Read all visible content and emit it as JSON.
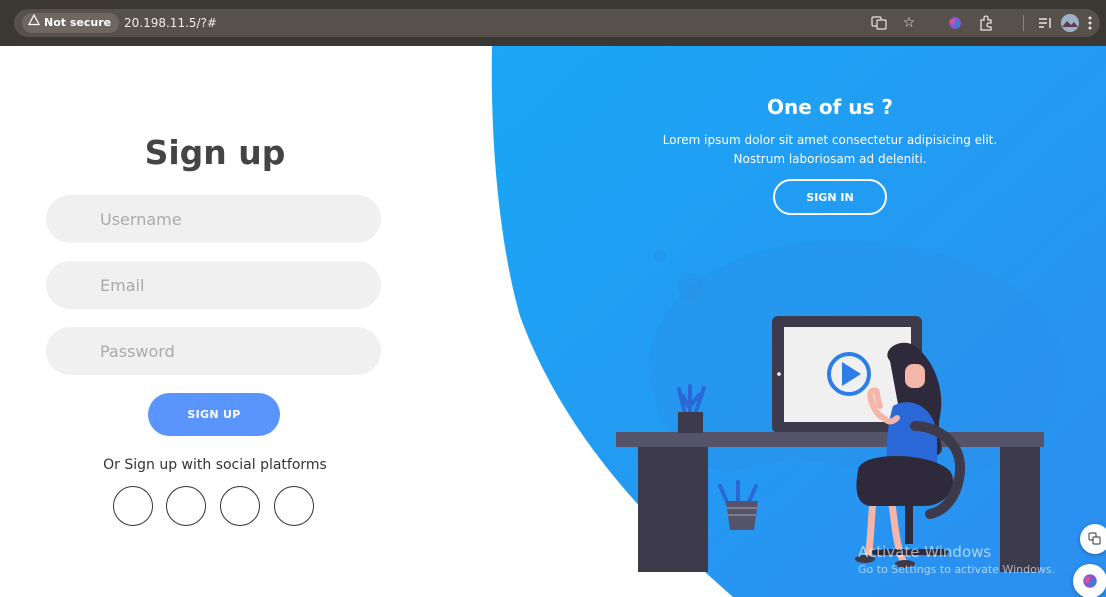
{
  "browser": {
    "security_label": "Not secure",
    "url": "20.198.11.5/?#"
  },
  "signup": {
    "title": "Sign up",
    "username_placeholder": "Username",
    "email_placeholder": "Email",
    "password_placeholder": "Password",
    "button_label": "SIGN UP",
    "social_text": "Or Sign up with social platforms"
  },
  "panel": {
    "title": "One of us ?",
    "text_line1": "Lorem ipsum dolor sit amet consectetur adipisicing elit.",
    "text_line2": "Nostrum laboriosam ad deleniti.",
    "button_label": "SIGN IN"
  },
  "watermark": {
    "line1": "Activate Windows",
    "line2": "Go to Settings to activate Windows."
  },
  "colors": {
    "primary": "#5995fd",
    "panel_gradient_start": "#1aa7f5",
    "panel_gradient_end": "#2c8ef0",
    "chrome": "#3b3833"
  },
  "icons": [
    "warning-icon",
    "translate-icon",
    "star-icon",
    "extension-icon",
    "puzzle-icon",
    "reading-list-icon",
    "profile-avatar",
    "menu-icon",
    "play-icon"
  ]
}
